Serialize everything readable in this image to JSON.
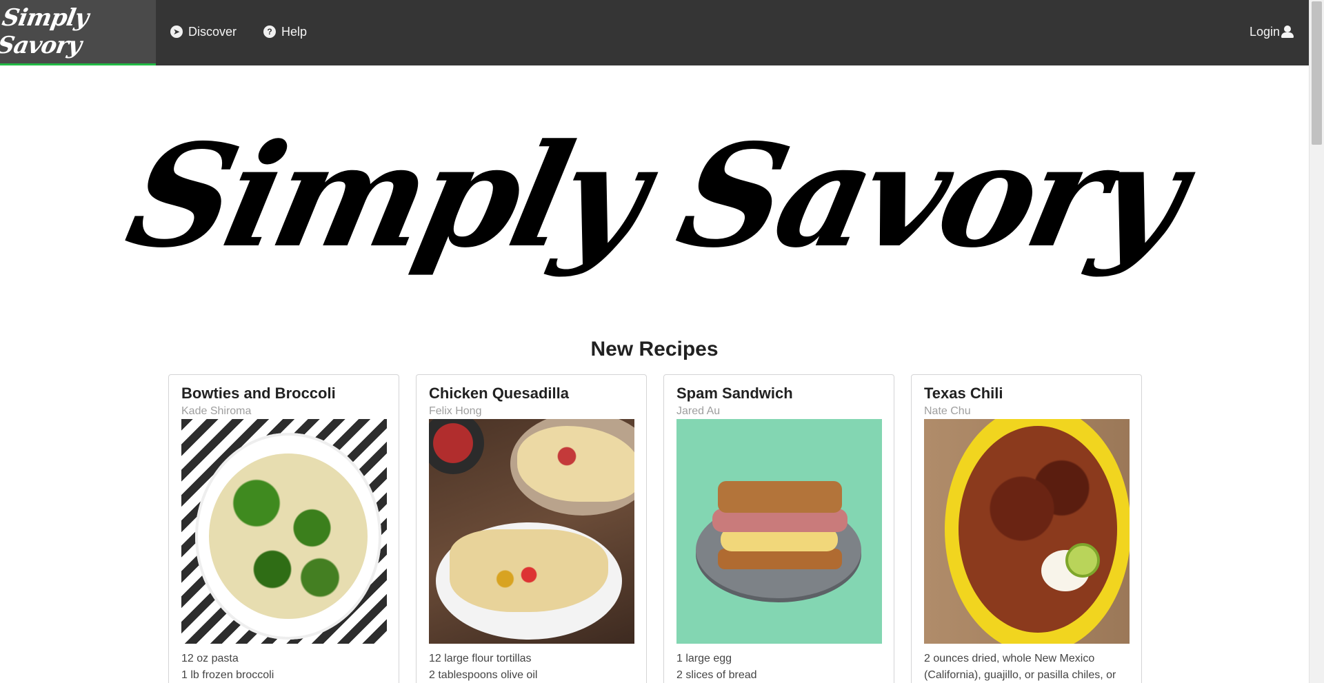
{
  "nav": {
    "brand": "Simply Savory",
    "items": [
      {
        "label": "Discover",
        "icon": "compass-icon"
      },
      {
        "label": "Help",
        "icon": "question-circle-icon"
      }
    ],
    "login": "Login",
    "accent_color": "#21ba45"
  },
  "hero": {
    "logo": "Simply Savory"
  },
  "section": {
    "title": "New Recipes"
  },
  "recipes": [
    {
      "title": "Bowties and Broccoli",
      "author": "Kade Shiroma",
      "ingredients": [
        "12 oz pasta",
        "1 lb frozen broccoli"
      ]
    },
    {
      "title": "Chicken Quesadilla",
      "author": "Felix Hong",
      "ingredients": [
        "12 large flour tortillas",
        "2 tablespoons olive oil"
      ]
    },
    {
      "title": "Spam Sandwich",
      "author": "Jared Au",
      "ingredients": [
        "1 large egg",
        "2 slices of bread"
      ]
    },
    {
      "title": "Texas Chili",
      "author": "Nate Chu",
      "ingredients": [
        "2 ounces dried, whole New Mexico",
        "(California), guajillo, or pasilla chiles, or"
      ]
    }
  ]
}
